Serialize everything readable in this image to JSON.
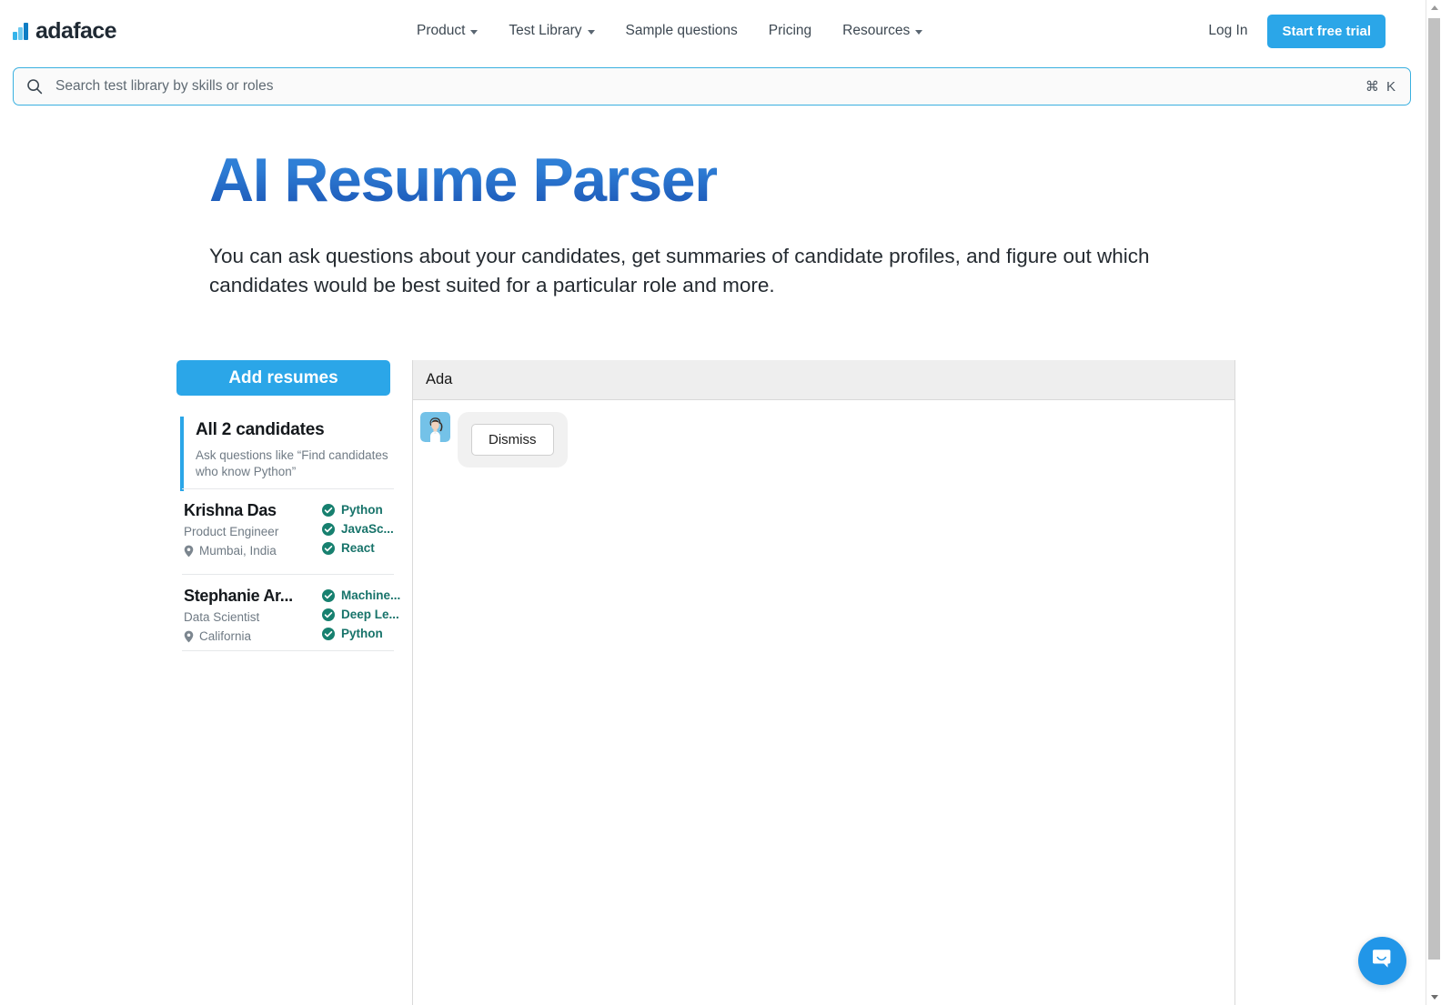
{
  "navbar": {
    "logo_text": "adaface",
    "links": [
      {
        "label": "Product",
        "has_caret": true
      },
      {
        "label": "Test Library",
        "has_caret": true
      },
      {
        "label": "Sample questions",
        "has_caret": false
      },
      {
        "label": "Pricing",
        "has_caret": false
      },
      {
        "label": "Resources",
        "has_caret": true
      }
    ],
    "login_label": "Log In",
    "trial_label": "Start free trial"
  },
  "search": {
    "placeholder": "Search test library by skills or roles",
    "shortcut": "⌘ K"
  },
  "hero": {
    "title": "AI Resume Parser",
    "subtitle": "You can ask questions about your candidates, get summaries of candidate profiles, and figure out which candidates would be best suited for a particular role and more."
  },
  "sidebar": {
    "add_resumes_label": "Add resumes",
    "all_candidates": {
      "title": "All 2 candidates",
      "hint": "Ask questions like “Find candidates who know Python”"
    },
    "candidates": [
      {
        "name": "Krishna Das",
        "role": "Product Engineer",
        "location": "Mumbai, India",
        "skills": [
          "Python",
          "JavaSc...",
          "React"
        ]
      },
      {
        "name": "Stephanie Ar...",
        "role": "Data Scientist",
        "location": "California",
        "skills": [
          "Machine...",
          "Deep Le...",
          "Python"
        ]
      }
    ]
  },
  "chat": {
    "header_title": "Ada",
    "messages": [
      {
        "sender": "Ada",
        "button_label": "Dismiss"
      }
    ]
  },
  "colors": {
    "brand_blue": "#2ba6e8",
    "title_gradient_start": "#2f7fd6",
    "title_gradient_end": "#1b55b5",
    "skill_teal": "#17736a",
    "header_gray": "#eeeeee"
  }
}
